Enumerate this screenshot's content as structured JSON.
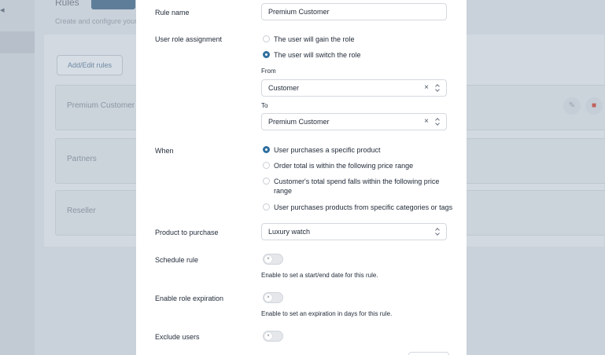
{
  "background": {
    "page_title": "Rules",
    "description": "Create and configure your",
    "add_rules_label": "Add/Edit rules",
    "rows": [
      "Premium Customer",
      "Partners",
      "Reseller"
    ]
  },
  "modal": {
    "rule_name": {
      "label": "Rule name",
      "value": "Premium Customer"
    },
    "role_assignment": {
      "label": "User role assignment",
      "options": [
        "The user will gain the role",
        "The user will switch the role"
      ],
      "selected_index": 1,
      "from_label": "From",
      "from_value": "Customer",
      "to_label": "To",
      "to_value": "Premium Customer"
    },
    "when": {
      "label": "When",
      "options": [
        "User purchases a specific product",
        "Order total is within the following price range",
        "Customer's total spend falls within the following price range",
        "User purchases products from specific categories or tags"
      ],
      "selected_index": 0
    },
    "product": {
      "label": "Product to purchase",
      "value": "Luxury watch"
    },
    "schedule": {
      "label": "Schedule rule",
      "help": "Enable to set a start/end date for this rule.",
      "enabled": false
    },
    "expiration": {
      "label": "Enable role expiration",
      "help": "Enable to set an expiration in days for this rule.",
      "enabled": false
    },
    "exclude": {
      "label": "Exclude users",
      "enabled": false
    },
    "clear_glyph": "×",
    "toggle_glyph": "×"
  },
  "colors": {
    "accent": "#2f6f9e",
    "overlay": "#c9d1da"
  }
}
